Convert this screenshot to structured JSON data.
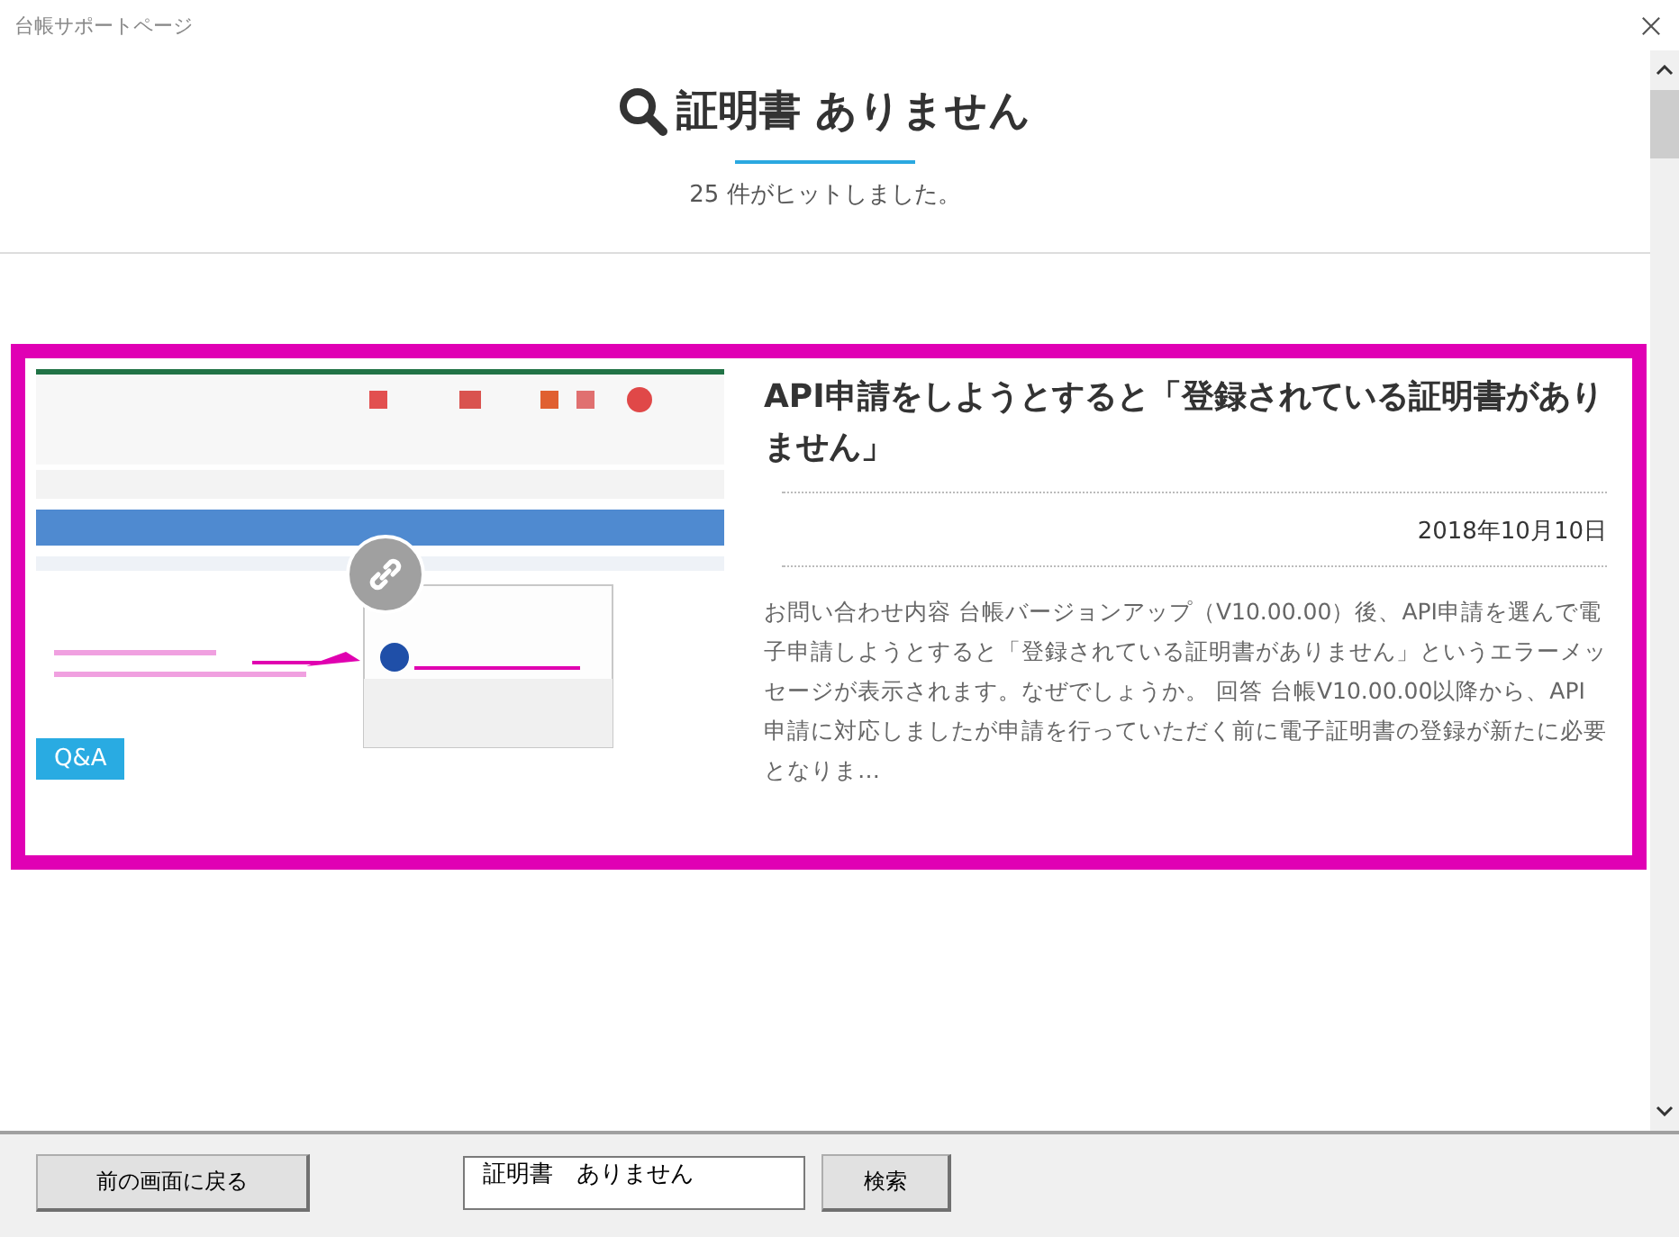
{
  "window": {
    "title": "台帳サポートページ"
  },
  "header": {
    "query": "証明書 ありません",
    "hit_count": "25 件がヒットしました。"
  },
  "results": [
    {
      "selected": true,
      "category": "Q&A",
      "title": "API申請をしようとすると「登録されている証明書がありません」",
      "date": "2018年10月10日",
      "excerpt": "お問い合わせ内容 台帳バージョンアップ（V10.00.00）後、API申請を選んで電子申請しようとすると「登録されている証明書がありません」というエラーメッセージが表示されます。なぜでしょうか。 回答 台帳V10.00.00以降から、API申請に対応しましたが申請を行っていただく前に電子証明書の登録が新たに必要となりま…"
    }
  ],
  "footer": {
    "back_button": "前の画面に戻る",
    "search_value": "証明書　ありません",
    "search_button": "検索"
  }
}
